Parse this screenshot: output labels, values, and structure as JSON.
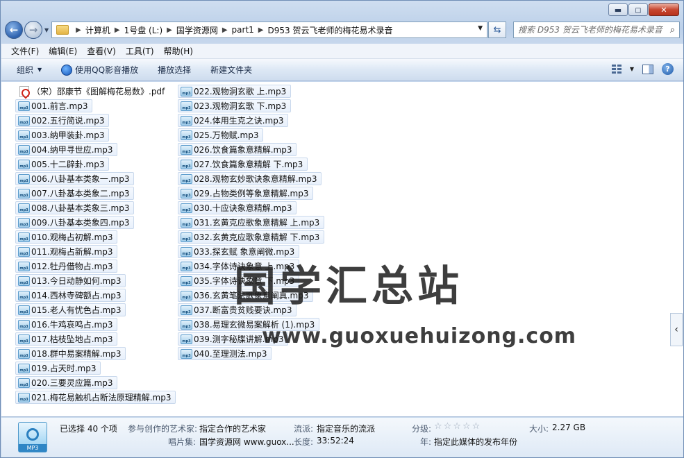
{
  "caption": {
    "minimize": "▬",
    "maximize": "◻",
    "close": "✕"
  },
  "address": {
    "breadcrumbs": [
      "计算机",
      "1号盘 (L:)",
      "国学资源网",
      "part1",
      "D953 贺云飞老师的梅花易术录音"
    ]
  },
  "search": {
    "placeholder": "搜索 D953 贺云飞老师的梅花易术录音"
  },
  "menu": [
    "文件(F)",
    "编辑(E)",
    "查看(V)",
    "工具(T)",
    "帮助(H)"
  ],
  "toolbar": {
    "organize": "组织",
    "qq_play": "使用QQ影音播放",
    "play_selection": "播放选择",
    "new_folder": "新建文件夹"
  },
  "files": {
    "column1": [
      {
        "name": "（宋）邵康节《图解梅花易数》.pdf",
        "type": "pdf"
      },
      {
        "name": "001.前言.mp3",
        "type": "mp3"
      },
      {
        "name": "002.五行简说.mp3",
        "type": "mp3"
      },
      {
        "name": "003.纳甲装卦.mp3",
        "type": "mp3"
      },
      {
        "name": "004.纳甲寻世应.mp3",
        "type": "mp3"
      },
      {
        "name": "005.十二辟卦.mp3",
        "type": "mp3"
      },
      {
        "name": "006.八卦基本类象一.mp3",
        "type": "mp3"
      },
      {
        "name": "007.八卦基本类象二.mp3",
        "type": "mp3"
      },
      {
        "name": "008.八卦基本类象三.mp3",
        "type": "mp3"
      },
      {
        "name": "009.八卦基本类象四.mp3",
        "type": "mp3"
      },
      {
        "name": "010.观梅占初解.mp3",
        "type": "mp3"
      },
      {
        "name": "011.观梅占新解.mp3",
        "type": "mp3"
      },
      {
        "name": "012.牡丹借物占.mp3",
        "type": "mp3"
      },
      {
        "name": "013.今日动静如何.mp3",
        "type": "mp3"
      },
      {
        "name": "014.西林寺碑额占.mp3",
        "type": "mp3"
      },
      {
        "name": "015.老人有忧色占.mp3",
        "type": "mp3"
      },
      {
        "name": "016.牛鸡哀鸣占.mp3",
        "type": "mp3"
      },
      {
        "name": "017.枯枝坠地占.mp3",
        "type": "mp3"
      },
      {
        "name": "018.群中易案精解.mp3",
        "type": "mp3"
      },
      {
        "name": "019.占天时.mp3",
        "type": "mp3"
      },
      {
        "name": "020.三要灵应篇.mp3",
        "type": "mp3"
      },
      {
        "name": "021.梅花易触机占断法原理精解.mp3",
        "type": "mp3"
      }
    ],
    "column2": [
      {
        "name": "022.观物洞玄歌 上.mp3",
        "type": "mp3"
      },
      {
        "name": "023.观物洞玄歌 下.mp3",
        "type": "mp3"
      },
      {
        "name": "024.体用生克之诀.mp3",
        "type": "mp3"
      },
      {
        "name": "025.万物赋.mp3",
        "type": "mp3"
      },
      {
        "name": "026.饮食篇象意精解.mp3",
        "type": "mp3"
      },
      {
        "name": "027.饮食篇象意精解 下.mp3",
        "type": "mp3"
      },
      {
        "name": "028.观物玄妙歌诀象意精解.mp3",
        "type": "mp3"
      },
      {
        "name": "029.占物类例等象意精解.mp3",
        "type": "mp3"
      },
      {
        "name": "030.十应诀象意精解.mp3",
        "type": "mp3"
      },
      {
        "name": "031.玄黄克应歌象意精解 上.mp3",
        "type": "mp3"
      },
      {
        "name": "032.玄黄克应歌象意精解 下.mp3",
        "type": "mp3"
      },
      {
        "name": "033.探玄赋 象意阐微.mp3",
        "type": "mp3"
      },
      {
        "name": "034.字体诗诀象意 上.mp3",
        "type": "mp3"
      },
      {
        "name": "035.字体诗诀象意 下.mp3",
        "type": "mp3"
      },
      {
        "name": "036.玄黄笔法歌象意阐真.mp3",
        "type": "mp3"
      },
      {
        "name": "037.断富贵贫贱要诀.mp3",
        "type": "mp3"
      },
      {
        "name": "038.易理玄微易案解析 (1).mp3",
        "type": "mp3"
      },
      {
        "name": "039.测字秘牒讲解.mp3",
        "type": "mp3"
      },
      {
        "name": "040.至理测法.mp3",
        "type": "mp3"
      }
    ]
  },
  "watermark": {
    "main": "国学汇总站",
    "sub": "www.guoxuehuizong.com"
  },
  "icons": {
    "mp3_small": "mp3",
    "mp3_big": "MP3"
  },
  "details": {
    "selected": "已选择 40 个项",
    "artist_label": "参与创作的艺术家:",
    "artist_value": "指定合作的艺术家",
    "genre_label": "流派:",
    "genre_value": "指定音乐的流派",
    "rating_label": "分级:",
    "rating_stars": "☆☆☆☆☆",
    "size_label": "大小:",
    "size_value": "2.27 GB",
    "album_label": "唱片集:",
    "album_value": "国学资源网 www.guox...",
    "length_label": "长度:",
    "length_value": "33:52:24",
    "year_label": "年:",
    "year_value": "指定此媒体的发布年份"
  }
}
